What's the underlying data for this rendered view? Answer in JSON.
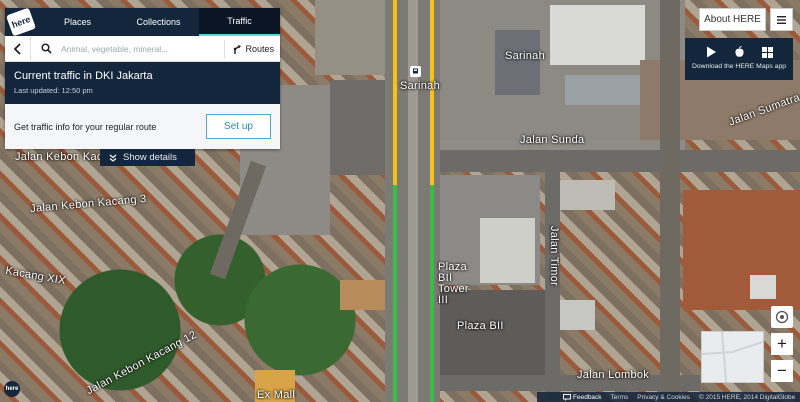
{
  "header": {
    "logo_text": "here",
    "tabs": [
      "Places",
      "Collections",
      "Traffic"
    ]
  },
  "search": {
    "placeholder": "Animal, vegetable, mineral...",
    "routes_label": "Routes"
  },
  "traffic": {
    "title": "Current traffic in DKI Jakarta",
    "last_updated": "Last updated: 12:50 pm"
  },
  "regular_route": {
    "text": "Get traffic info for your regular route",
    "button": "Set up"
  },
  "show_details": "Show details",
  "top_right": {
    "about": "About HERE",
    "download": "Download the HERE Maps app"
  },
  "map_labels": {
    "sarinah_top": "Sarinah",
    "sarinah_station": "Sarinah",
    "jalan_sumatra": "Jalan Sumatra",
    "jalan_sunda": "Jalan Sunda",
    "jalan_kebon_kacang": "Jalan Kebon Kacang",
    "jalan_kebon_kacang_3": "Jalan Kebon Kacang 3",
    "kacang_xix": "Kacang XIX",
    "jalan_kebon_kacang_12": "Jalan Kebon Kacang 12",
    "jalan_timor": "Jalan Timor",
    "plaza_bii_tower_iii": "Plaza BII Tower III",
    "plaza_bii": "Plaza BII",
    "jalan_lombok": "Jalan Lombok",
    "ex_mall": "Ex Mall"
  },
  "footer": {
    "feedback": "Feedback",
    "terms": "Terms",
    "privacy": "Privacy & Cookies",
    "copyright": "© 2015 HERE, 2014 DigitalGlobe"
  },
  "colors": {
    "navy": "#14263c",
    "accent": "#5fd6d6",
    "traffic_yellow": "#f3c21b",
    "traffic_green": "#3dbb4a"
  }
}
